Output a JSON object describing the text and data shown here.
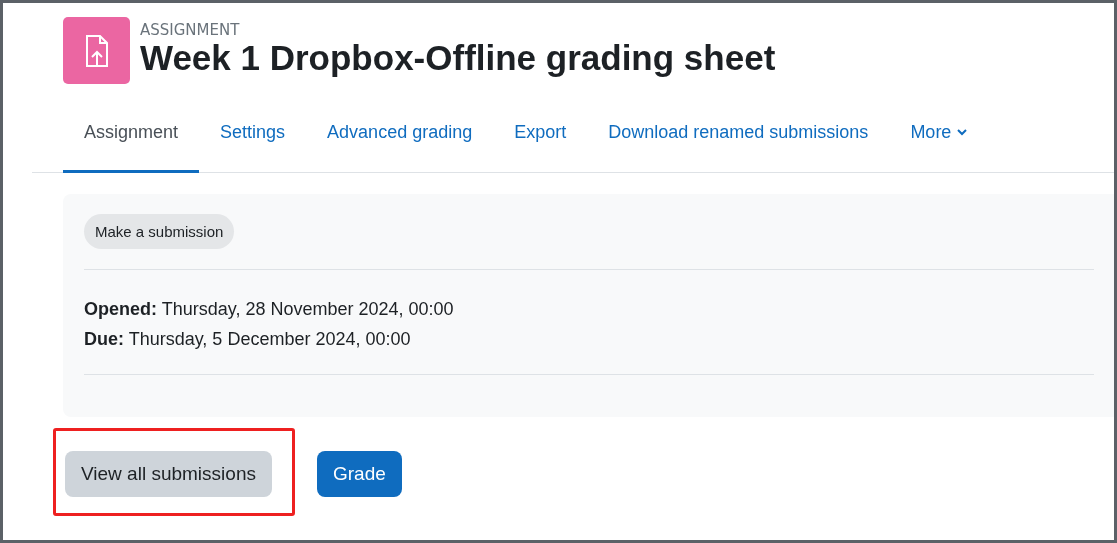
{
  "header": {
    "module_type": "ASSIGNMENT",
    "title": "Week 1 Dropbox-Offline grading sheet"
  },
  "tabs": [
    {
      "label": "Assignment",
      "selected": true
    },
    {
      "label": "Settings",
      "selected": false
    },
    {
      "label": "Advanced grading",
      "selected": false
    },
    {
      "label": "Export",
      "selected": false
    },
    {
      "label": "Download renamed submissions",
      "selected": false
    },
    {
      "label": "More",
      "selected": false,
      "kind": "dropdown"
    }
  ],
  "activity": {
    "action_button": "Make a submission",
    "dates": [
      "**Opened:** Thursday, 28 November 2024, 00:00",
      "**Due:** Thursday, 5 December 2024, 00:00"
    ]
  },
  "buttons": [
    {
      "label": "View all submissions",
      "kind": "secondary",
      "highlighted": true
    },
    {
      "label": "Grade",
      "kind": "primary",
      "highlighted": false
    }
  ]
}
